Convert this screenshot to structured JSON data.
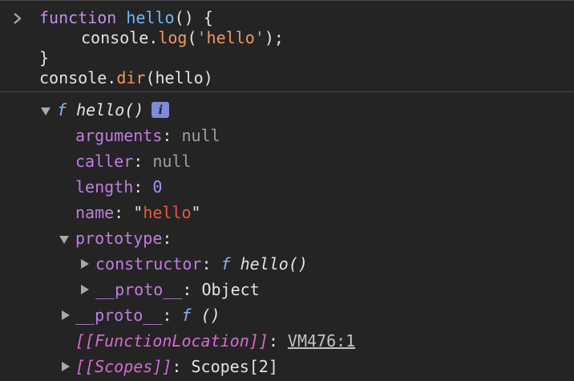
{
  "input": {
    "line1": {
      "kw": "function",
      "name": "hello",
      "rest": "() {"
    },
    "line2": {
      "obj": "console",
      "dot": ".",
      "method": "log",
      "open": "(",
      "arg": "'hello'",
      "close": ");"
    },
    "line3": "}",
    "line4": {
      "obj": "console",
      "dot": ".",
      "method": "dir",
      "rest": "(hello)"
    }
  },
  "output": {
    "root": {
      "f": "f",
      "sig": "hello()",
      "badge": "i"
    },
    "props": [
      {
        "key": "arguments",
        "sep": ": ",
        "value": "null"
      },
      {
        "key": "caller",
        "sep": ": ",
        "value": "null"
      },
      {
        "key": "length",
        "sep": ": ",
        "value": "0"
      },
      {
        "key": "name",
        "sep": ": ",
        "q1": "\"",
        "value": "hello",
        "q2": "\""
      }
    ],
    "prototype": {
      "key": "prototype",
      "sep": ":"
    },
    "constructor": {
      "key": "constructor",
      "sep": ": ",
      "f": "f",
      "sig": "hello()"
    },
    "proto_inner": {
      "key": "__proto__",
      "sep": ": ",
      "value": "Object"
    },
    "proto_outer": {
      "key": "__proto__",
      "sep": ": ",
      "f": "f",
      "sig": "()"
    },
    "function_location": {
      "key": "[[FunctionLocation]]",
      "sep": ": ",
      "link": "VM476:1"
    },
    "scopes": {
      "key": "[[Scopes]]",
      "sep": ": ",
      "value": "Scopes[2]"
    }
  },
  "colors": {
    "background": "#242424",
    "keyword": "#c58ee6",
    "function_name": "#6fb8ff",
    "string": "#f29766",
    "property": "#c27ce0",
    "number": "#9d98ff",
    "string_value": "#f2553d",
    "internal_property": "#d86ad0",
    "info_badge": "#7f8bd6"
  },
  "icons": {
    "prompt": "chevron-right-icon",
    "expanded": "triangle-down-icon",
    "collapsed": "triangle-right-icon",
    "info": "info-badge-icon"
  }
}
